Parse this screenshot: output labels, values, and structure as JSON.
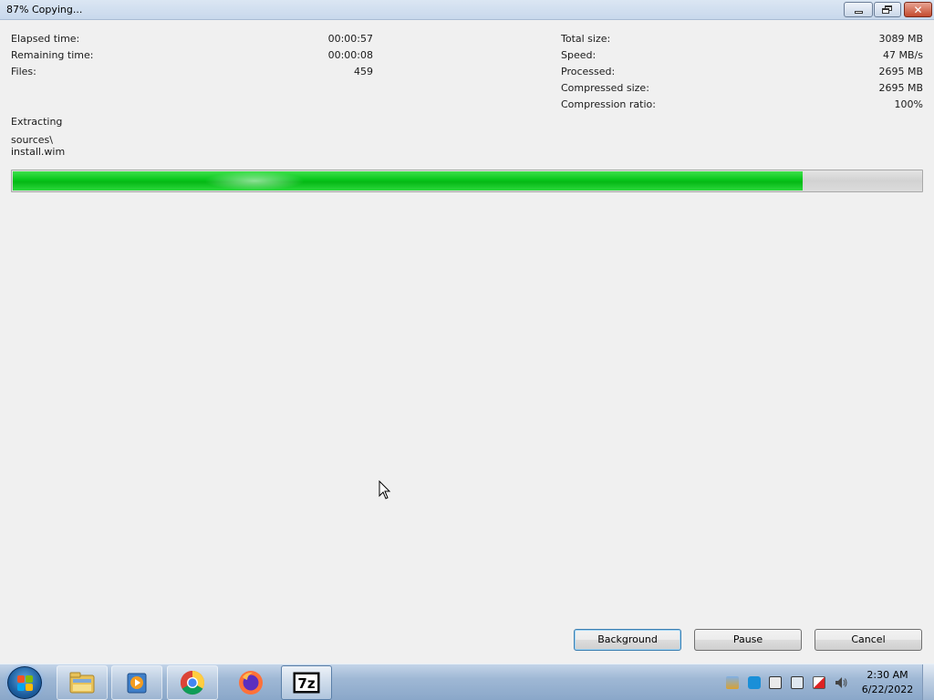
{
  "window": {
    "title": "87% Copying...",
    "controls": {
      "minimize": "minimize",
      "maximize": "maximize",
      "close": "close"
    }
  },
  "stats_left": [
    {
      "label": "Elapsed time:",
      "value": "00:00:57"
    },
    {
      "label": "Remaining time:",
      "value": "00:00:08"
    },
    {
      "label": "Files:",
      "value": "459"
    }
  ],
  "stats_right": [
    {
      "label": "Total size:",
      "value": "3089 MB"
    },
    {
      "label": "Speed:",
      "value": "47 MB/s"
    },
    {
      "label": "Processed:",
      "value": "2695 MB"
    },
    {
      "label": "Compressed size:",
      "value": "2695 MB"
    },
    {
      "label": "Compression ratio:",
      "value": "100%"
    }
  ],
  "operation": {
    "label": "Extracting",
    "path_line1": "sources\\",
    "path_line2": "install.wim"
  },
  "progress": {
    "percent": 87,
    "color": "#06c61a"
  },
  "buttons": {
    "background": "Background",
    "pause": "Pause",
    "cancel": "Cancel"
  },
  "taskbar": {
    "start_icon": "windows-logo-icon",
    "apps": [
      {
        "name": "file-explorer",
        "icon": "folder-icon"
      },
      {
        "name": "media-player",
        "icon": "media-player-icon"
      },
      {
        "name": "chrome",
        "icon": "chrome-icon"
      },
      {
        "name": "firefox",
        "icon": "firefox-icon"
      },
      {
        "name": "7-zip",
        "icon": "7zip-icon",
        "text": "7z",
        "active": true
      }
    ],
    "tray_icons": [
      "network-flag-icon",
      "remote-icon",
      "display-icon",
      "network-icon",
      "action-center-icon",
      "volume-icon"
    ],
    "clock": {
      "time": "2:30 AM",
      "date": "6/22/2022"
    }
  }
}
